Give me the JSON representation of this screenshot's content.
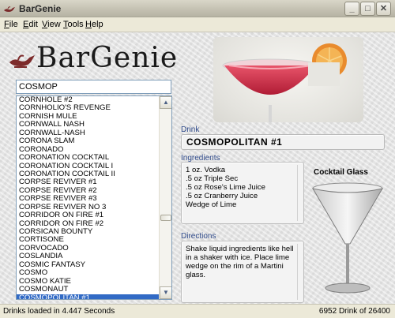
{
  "window": {
    "title": "BarGenie"
  },
  "menu": [
    "File",
    "Edit",
    "View",
    "Tools",
    "Help"
  ],
  "logo": {
    "text": "BarGenie",
    "icon": "genie-lamp-icon"
  },
  "search": {
    "value": "COSMOP"
  },
  "drink_list": {
    "items": [
      "CORNHOLE #2",
      "CORNHOLIO'S REVENGE",
      "CORNISH MULE",
      "CORNWALL NASH",
      "CORNWALL-NASH",
      "CORONA SLAM",
      "CORONADO",
      "CORONATION COCKTAIL",
      "CORONATION COCKTAIL I",
      "CORONATION COCKTAIL II",
      "CORPSE REVIVER #1",
      "CORPSE REVIVER #2",
      "CORPSE REVIVER #3",
      "CORPSE REVIVER NO 3",
      "CORRIDOR ON FIRE #1",
      "CORRIDOR ON FIRE #2",
      "CORSICAN BOUNTY",
      "CORTISONE",
      "CORVOCADO",
      "COSLANDIA",
      "COSMIC FANTASY",
      "COSMO",
      "COSMO KATIE",
      "COSMONAUT",
      "COSMOPOLITAN #1"
    ],
    "selected": "COSMOPOLITAN #1"
  },
  "detail": {
    "drink_label": "Drink",
    "drink_name": "COSMOPOLITAN #1",
    "ingredients_label": "Ingredients",
    "ingredients": [
      "1 oz. Vodka",
      ".5 oz Triple Sec",
      ".5 oz Rose's Lime Juice",
      ".5 oz Cranberry Juice",
      "Wedge of Lime"
    ],
    "directions_label": "Directions",
    "directions": "Shake liquid ingredients like hell in a shaker with ice. Place lime wedge on the rim of a Martini glass.",
    "glass_label": "Cocktail Glass"
  },
  "status": {
    "left": "Drinks loaded in 4.447 Seconds",
    "right": "6952 Drink of 26400"
  },
  "colors": {
    "selection": "#316ac5",
    "label_blue": "#2f4a8a",
    "drink_red": "#c8263e"
  }
}
